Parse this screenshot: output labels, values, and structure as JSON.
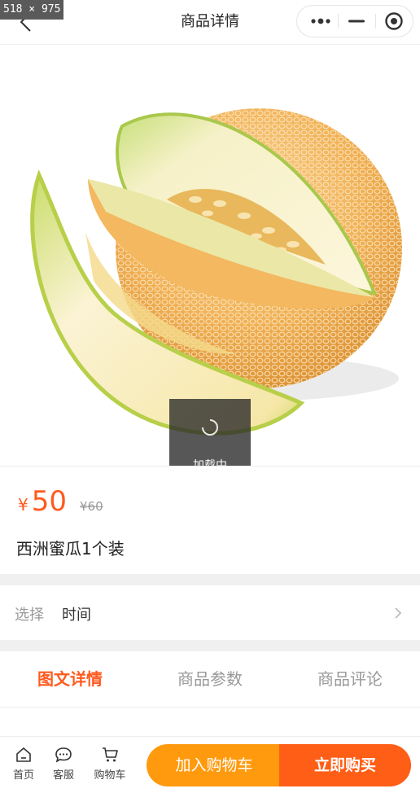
{
  "screenshot_tag": "518 × 975",
  "navbar": {
    "title": "商品详情",
    "back_icon": "chevron-left-icon",
    "capsule": {
      "more_icon": "more-dots-icon",
      "minimize_icon": "minimize-icon",
      "close_icon": "target-circle-icon"
    }
  },
  "hero": {
    "image": "melon-product-photo",
    "loading_label": "加载中"
  },
  "product": {
    "currency": "¥",
    "price": "50",
    "old_price": "¥60",
    "name": "西洲蜜瓜1个装"
  },
  "spec": {
    "label": "选择",
    "value": "时间",
    "chevron_icon": "chevron-right-icon"
  },
  "tabs": [
    {
      "label": "图文详情",
      "active": true
    },
    {
      "label": "商品参数",
      "active": false
    },
    {
      "label": "商品评论",
      "active": false
    }
  ],
  "bottom_bar": {
    "home": {
      "label": "首页",
      "icon": "home-icon"
    },
    "service": {
      "label": "客服",
      "icon": "chat-bubble-icon"
    },
    "cart": {
      "label": "购物车",
      "icon": "cart-icon"
    },
    "add_to_cart": "加入购物车",
    "buy_now": "立即购买"
  },
  "colors": {
    "accent": "#ff5a1f",
    "cart_button": "#ff9a0e",
    "buy_button": "#ff5e16",
    "muted": "#999999"
  }
}
